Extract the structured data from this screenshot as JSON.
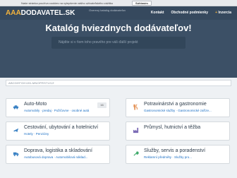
{
  "cookie_bar": {
    "text": "Naše stránka používa cookies na vylepšenie vášho užívateľského zážitku",
    "button": "Súhlasím"
  },
  "header": {
    "logo_a": "AAA",
    "logo_b": "DODAVATEL.SK",
    "tagline": "Overený katalóg dodávateľov",
    "nav": [
      "Kontakt",
      "Obchodné podmienky",
      "Inzercia"
    ],
    "nav_plus": "+"
  },
  "hero": {
    "title": "Katalóg hviezdnych dodávateľov!",
    "search_placeholder": "Nájdite si v ňom toho pravého pre váš ďalší projekt"
  },
  "alphabet": "ABCDEFGHIJKLMNOPRSTUVZ",
  "categories": [
    {
      "title": "Auto-Moto",
      "sub": "Automobily · predaj · Požičovne · osobné autá",
      "count": "16",
      "icon": "car-icon",
      "color": "#3b82c4"
    },
    {
      "title": "Potravinárstvi a gastronomie",
      "sub": "Gastronomické služby · Gastronomické zaříze...",
      "count": "",
      "icon": "food-icon",
      "color": "#e0813a"
    },
    {
      "title": "Cestování, ubytování a hotelnictví",
      "sub": "Hotely · Penzióny",
      "count": "",
      "icon": "plane-icon",
      "color": "#3b82c4"
    },
    {
      "title": "Průmysl, hutnictví a těžba",
      "sub": "",
      "count": "",
      "icon": "factory-icon",
      "color": "#7b6bb5"
    },
    {
      "title": "Doprava, logistika a skladování",
      "sub": "Autobusová doprava · Automobilová náklad...",
      "count": "",
      "icon": "truck-icon",
      "color": "#3b82c4"
    },
    {
      "title": "Služby, servis a poradenství",
      "sub": "Reklamní předměty · Služby pro...",
      "count": "",
      "icon": "service-icon",
      "color": "#3faa6b"
    }
  ]
}
